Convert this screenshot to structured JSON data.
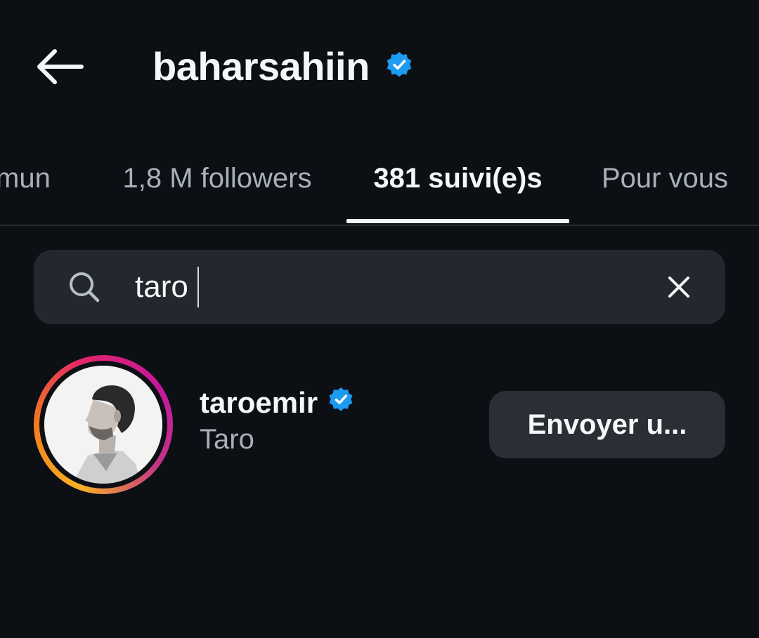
{
  "header": {
    "username": "baharsahiin",
    "verified": true
  },
  "tabs": [
    {
      "label": "mun",
      "active": false
    },
    {
      "label": "1,8 M followers",
      "active": false
    },
    {
      "label": "381 suivi(e)s",
      "active": true
    },
    {
      "label": "Pour vous",
      "active": false
    }
  ],
  "search": {
    "value": "taro"
  },
  "results": [
    {
      "username": "taroemir",
      "full_name": "Taro",
      "verified": true,
      "action_label": "Envoyer u..."
    }
  ],
  "colors": {
    "background": "#0c0f14",
    "verified_badge": "#1d9bf0",
    "search_bg": "#23272e",
    "button_bg": "#2a2e35"
  },
  "icons": [
    "back-arrow-icon",
    "verified-badge-icon",
    "search-icon",
    "close-icon"
  ]
}
